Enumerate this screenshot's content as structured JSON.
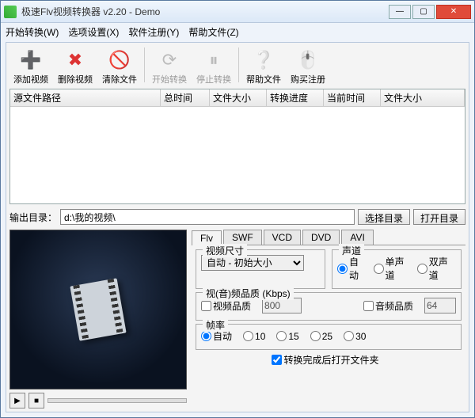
{
  "window": {
    "title": "极速Flv视频转换器 v2.20 - Demo"
  },
  "menu": {
    "start": "开始转换(W)",
    "options": "选项设置(X)",
    "register": "软件注册(Y)",
    "help": "帮助文件(Z)"
  },
  "toolbar": {
    "add": "添加视频",
    "del": "删除视频",
    "clear": "清除文件",
    "startconv": "开始转换",
    "stopconv": "停止转换",
    "helpfile": "帮助文件",
    "buy": "购买注册"
  },
  "columns": {
    "src": "源文件路径",
    "totaltime": "总时间",
    "filesize": "文件大小",
    "progress": "转换进度",
    "curtime": "当前时间",
    "outsize": "文件大小"
  },
  "output": {
    "label": "输出目录：",
    "path": "d:\\我的视频\\",
    "choose": "选择目录",
    "open": "打开目录"
  },
  "tabs": {
    "flv": "Flv",
    "swf": "SWF",
    "vcd": "VCD",
    "dvd": "DVD",
    "avi": "AVI"
  },
  "videosize": {
    "legend": "视频尺寸",
    "selected": "自动 - 初始大小"
  },
  "channel": {
    "legend": "声道",
    "auto": "自动",
    "mono": "单声道",
    "stereo": "双声道"
  },
  "quality": {
    "legend": "视(音)频品质 (Kbps)",
    "vlabel": "视频品质",
    "vval": "800",
    "alabel": "音频品质",
    "aval": "64"
  },
  "fps": {
    "legend": "帧率",
    "auto": "自动",
    "r10": "10",
    "r15": "15",
    "r25": "25",
    "r30": "30"
  },
  "finish": {
    "label": "转换完成后打开文件夹"
  }
}
